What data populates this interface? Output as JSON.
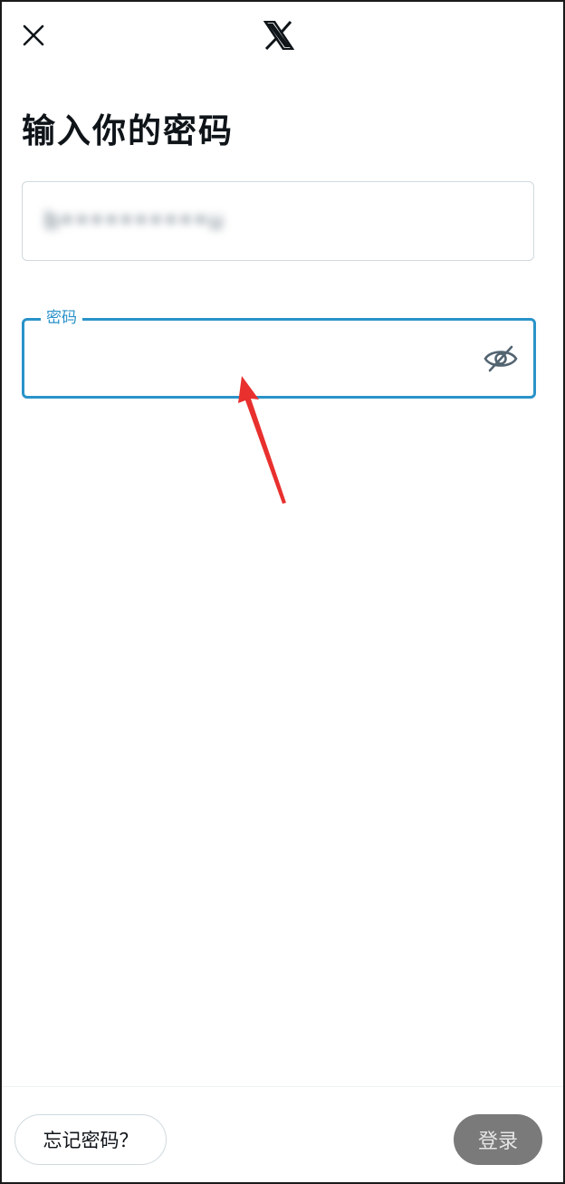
{
  "header": {
    "close_icon": "close-icon",
    "logo_icon": "x-logo-icon"
  },
  "main": {
    "title": "输入你的密码",
    "username": {
      "value": "b••••••••••u"
    },
    "password": {
      "label": "密码",
      "value": "",
      "visibility_icon": "eye-off-icon"
    }
  },
  "annotation": {
    "arrow_color": "#e8302e"
  },
  "footer": {
    "forgot_label": "忘记密码？",
    "login_label": "登录"
  },
  "colors": {
    "accent": "#2a93c9",
    "login_disabled_bg": "#7a7a7a"
  }
}
